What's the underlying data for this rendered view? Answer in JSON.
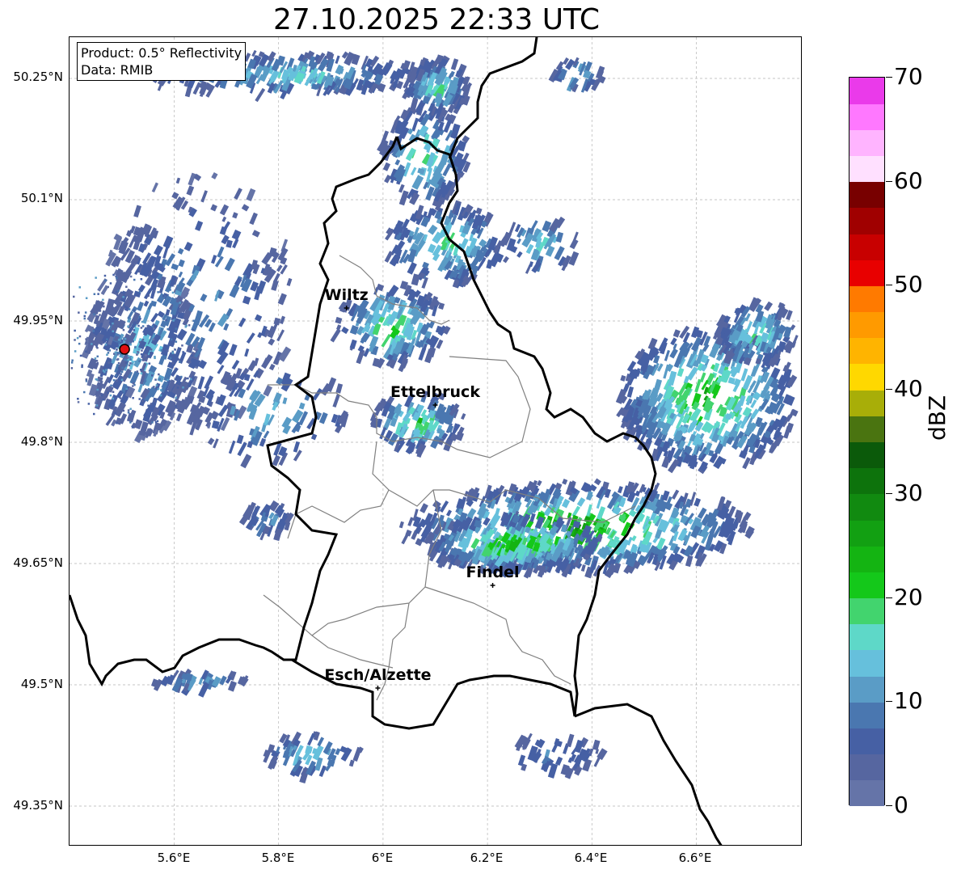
{
  "title": "27.10.2025 22:33 UTC",
  "info_box": {
    "product": "Product: 0.5° Reflectivity",
    "data": "Data: RMIB"
  },
  "axes": {
    "lat_ticks": [
      "50.25°N",
      "50.1°N",
      "49.95°N",
      "49.8°N",
      "49.65°N",
      "49.5°N",
      "49.35°N"
    ],
    "lon_ticks": [
      "5.6°E",
      "5.8°E",
      "6°E",
      "6.2°E",
      "6.4°E",
      "6.6°E"
    ]
  },
  "cities": [
    {
      "name": "Wiltz",
      "lon": 5.93,
      "lat": 49.966
    },
    {
      "name": "Ettelbruck",
      "lon": 6.1,
      "lat": 49.846
    },
    {
      "name": "Findel",
      "lon": 6.21,
      "lat": 49.623
    },
    {
      "name": "Esch/Alzette",
      "lon": 5.99,
      "lat": 49.496
    }
  ],
  "radar_site": {
    "lon": 5.505,
    "lat": 49.915,
    "color": "#e01010"
  },
  "colorbar": {
    "unit": "dBZ",
    "min": 0,
    "max": 70,
    "step": 2.5,
    "ticks": [
      "0",
      "10",
      "20",
      "30",
      "40",
      "50",
      "60",
      "70"
    ],
    "colors": [
      "#6574a8",
      "#5666a0",
      "#4660a4",
      "#4a77b0",
      "#5a9cc6",
      "#66c0dc",
      "#5ed8c8",
      "#42d46e",
      "#14c81a",
      "#14b412",
      "#12a012",
      "#118a10",
      "#0d730c",
      "#0b5a0a",
      "#4a7410",
      "#a8ae08",
      "#ffd800",
      "#ffb400",
      "#ff9a00",
      "#ff7a00",
      "#e80000",
      "#c80000",
      "#a00000",
      "#780000",
      "#ffe0ff",
      "#ffb4ff",
      "#ff78ff",
      "#ea3aea"
    ]
  },
  "colors": {
    "border_country": "#000000",
    "border_district": "#808080",
    "grid": "#b4b4b4"
  }
}
